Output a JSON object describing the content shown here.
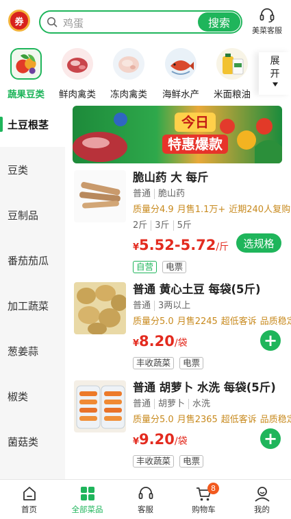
{
  "header": {
    "coupon_icon_label": "券",
    "search_placeholder": "鸡蛋",
    "search_button": "搜索",
    "service_label": "美菜客服"
  },
  "categories": [
    {
      "name": "蔬果豆类",
      "icon": "vegetables-image",
      "active": true
    },
    {
      "name": "鲜肉禽类",
      "icon": "fresh-meat-image",
      "active": false
    },
    {
      "name": "冻肉禽类",
      "icon": "frozen-meat-image",
      "active": false
    },
    {
      "name": "海鲜水产",
      "icon": "seafood-image",
      "active": false
    },
    {
      "name": "米面粮油",
      "icon": "rice-oil-image",
      "active": false
    }
  ],
  "expand_label_top": "展",
  "expand_label_bottom": "开",
  "sidebar": [
    {
      "label": "土豆根茎",
      "active": true
    },
    {
      "label": "豆类",
      "active": false
    },
    {
      "label": "豆制品",
      "active": false
    },
    {
      "label": "番茄茄瓜",
      "active": false
    },
    {
      "label": "加工蔬菜",
      "active": false
    },
    {
      "label": "葱姜蒜",
      "active": false
    },
    {
      "label": "椒类",
      "active": false
    },
    {
      "label": "菌菇类",
      "active": false
    }
  ],
  "banner": {
    "line1": "今日",
    "line2": "特惠爆款"
  },
  "products": [
    {
      "name": "脆山药 大 每斤",
      "tags": [
        "普通",
        "脆山药"
      ],
      "stats": [
        "质量分4.9",
        "月售1.1万+",
        "近期240人复购"
      ],
      "specs": [
        "2斤",
        "3斤",
        "5斤"
      ],
      "currency": "¥",
      "price": "5.52-5.72",
      "unit": "/斤",
      "badges": [
        {
          "label": "自营",
          "green": true
        },
        {
          "label": "电票",
          "green": false
        }
      ],
      "action": "选规格"
    },
    {
      "name": "普通 黄心土豆 每袋(5斤)",
      "tags": [
        "普通",
        "3两以上"
      ],
      "stats": [
        "质量分5.0",
        "月售2245",
        "超低客诉",
        "品质稳定"
      ],
      "currency": "¥",
      "price": "8.20",
      "unit": "/袋",
      "badges": [
        {
          "label": "丰收蔬菜",
          "green": false
        },
        {
          "label": "电票",
          "green": false
        }
      ],
      "action": "+"
    },
    {
      "name": "普通 胡萝卜 水洗 每袋(5斤)",
      "tags": [
        "普通",
        "胡萝卜",
        "水洗"
      ],
      "stats": [
        "质量分5.0",
        "月售2365",
        "超低客诉",
        "品质稳定"
      ],
      "currency": "¥",
      "price": "9.20",
      "unit": "/袋",
      "badges": [
        {
          "label": "丰收蔬菜",
          "green": false
        },
        {
          "label": "电票",
          "green": false
        }
      ],
      "action": "+"
    }
  ],
  "bottom_nav": [
    {
      "label": "首页",
      "icon": "home-icon",
      "active": false
    },
    {
      "label": "全部菜品",
      "icon": "grid-icon",
      "active": true
    },
    {
      "label": "客服",
      "icon": "headset-icon",
      "active": false
    },
    {
      "label": "购物车",
      "icon": "cart-icon",
      "active": false
    },
    {
      "label": "我的",
      "icon": "user-icon",
      "active": false
    }
  ],
  "cart_count": "8",
  "colors": {
    "accent": "#1fb55b",
    "price": "#e32b1f",
    "stats": "#c88a1e"
  }
}
